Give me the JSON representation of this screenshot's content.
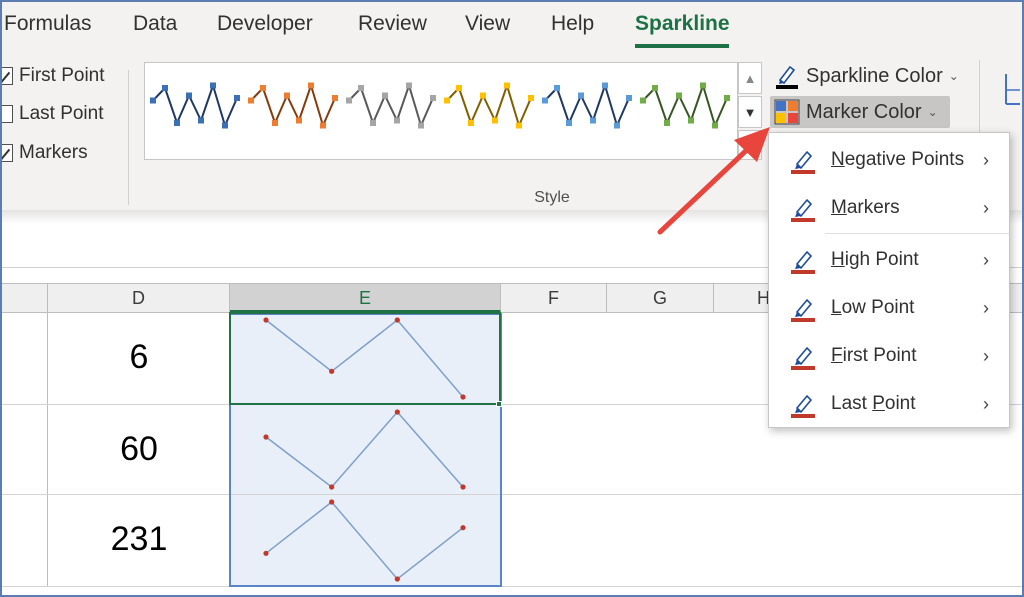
{
  "tabs": [
    {
      "label": "Formulas"
    },
    {
      "label": "Data"
    },
    {
      "label": "Developer"
    },
    {
      "label": "Review"
    },
    {
      "label": "View"
    },
    {
      "label": "Help"
    },
    {
      "label": "Sparkline"
    }
  ],
  "show": {
    "first_point": {
      "label": "First Point",
      "checked": true
    },
    "last_point": {
      "label": "Last Point",
      "checked": false
    },
    "markers": {
      "label": "Markers",
      "checked": true
    }
  },
  "style": {
    "group_label": "Style",
    "swatches": [
      {
        "line": "#1f3864",
        "marker": "#3b6fb6"
      },
      {
        "line": "#843c0c",
        "marker": "#ed7d31"
      },
      {
        "line": "#595959",
        "marker": "#a5a5a5"
      },
      {
        "line": "#7f6000",
        "marker": "#ffc000"
      },
      {
        "line": "#1f3864",
        "marker": "#5b9bd5"
      },
      {
        "line": "#375623",
        "marker": "#70ad47"
      }
    ]
  },
  "commands": {
    "sparkline_color": "Sparkline Color",
    "marker_color": "Marker Color"
  },
  "columns": [
    "D",
    "E",
    "F",
    "G",
    "H"
  ],
  "rows": [
    {
      "d": "6",
      "spark": [
        3,
        1,
        3,
        0
      ]
    },
    {
      "d": "60",
      "spark": [
        2,
        0,
        3,
        0
      ]
    },
    {
      "d": "231",
      "spark": [
        1,
        3,
        0,
        2
      ]
    }
  ],
  "marker_color_menu": [
    {
      "pre": "",
      "u": "N",
      "post": "egative Points"
    },
    {
      "pre": "",
      "u": "M",
      "post": "arkers"
    },
    {
      "pre": "",
      "u": "H",
      "post": "igh Point"
    },
    {
      "pre": "",
      "u": "L",
      "post": "ow Point"
    },
    {
      "pre": "",
      "u": "F",
      "post": "irst Point"
    },
    {
      "pre": "Last ",
      "u": "P",
      "post": "oint"
    }
  ],
  "colors": {
    "accent": "#1e7145",
    "sparkline": "#7f9fc9",
    "marker": "#c0392b",
    "annotation": "#e8453c"
  }
}
